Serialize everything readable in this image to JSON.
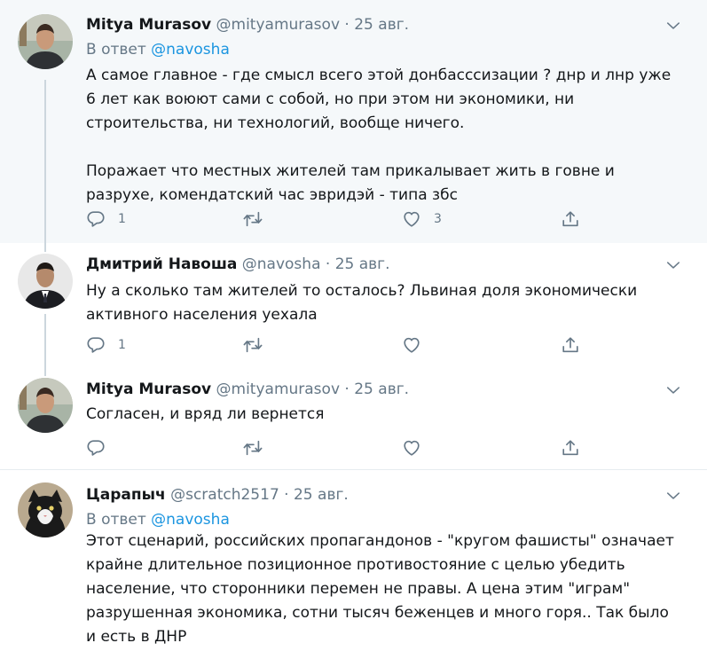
{
  "tweets": [
    {
      "name": "Mitya Murasov",
      "handle": "@mityamurasov",
      "separator": "·",
      "date": "25 авг.",
      "reply_prefix": "В ответ ",
      "reply_mention": "@navosha",
      "text": "А самое главное - где смысл всего этой донбасссизации ? днр и лнр уже\n6 лет как воюют сами с собой, но при этом ни экономики, ни\nстроительства, ни технологий, вообще ничего.\n\nПоражает что местных жителей там прикалывает жить в говне и\nразрухе, комендатский час эвридэй - типа збс",
      "replies": "1",
      "retweets": "",
      "likes": "3",
      "avatar_icon": "user-avatar-photo"
    },
    {
      "name": "Дмитрий Навоша",
      "handle": "@navosha",
      "separator": "·",
      "date": "25 авг.",
      "text": "Ну а сколько там жителей то осталось? Львиная доля экономически\nактивного населения уехала",
      "replies": "1",
      "retweets": "",
      "likes": "",
      "avatar_icon": "user-avatar-photo"
    },
    {
      "name": "Mitya Murasov",
      "handle": "@mityamurasov",
      "separator": "·",
      "date": "25 авг.",
      "text": "Согласен, и вряд ли вернется",
      "replies": "",
      "retweets": "",
      "likes": "",
      "avatar_icon": "user-avatar-photo"
    },
    {
      "name": "Царапыч",
      "handle": "@scratch2517",
      "separator": "·",
      "date": "25 авг.",
      "reply_prefix": "В ответ ",
      "reply_mention": "@navosha",
      "text": "Этот сценарий, российских пропагандонов - \"кругом фашисты\" означает\nкрайне длительное позиционное противостояние с целью убедить\nнаселение, что сторонники перемен не правы. А цена этим \"играм\"\nразрушенная экономика, сотни тысяч беженцев и много горя.. Так было\nи есть в ДНР",
      "avatar_icon": "cat-avatar-photo"
    }
  ],
  "colors": {
    "text": "#14171a",
    "secondary": "#657786",
    "link": "#1b95e0",
    "highlight_bg": "#f5f8fa",
    "thread_line": "#ccd6dd",
    "divider": "#e6ecf0"
  },
  "icons": {
    "reply": "reply-icon",
    "retweet": "retweet-icon",
    "like": "heart-icon",
    "share": "share-icon",
    "menu": "chevron-down-icon"
  }
}
